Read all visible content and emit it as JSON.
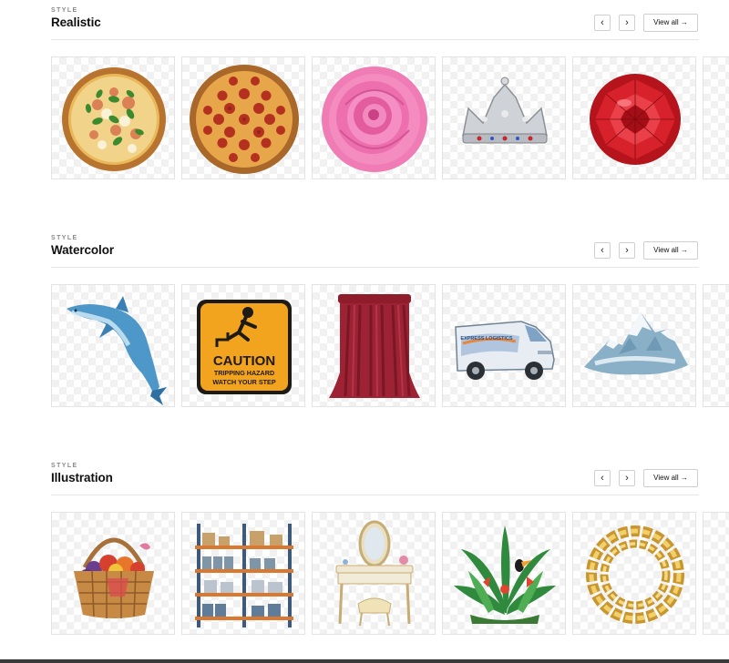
{
  "sections": [
    {
      "eyebrow": "STYLE",
      "title": "Realistic",
      "view_all": "View all →",
      "prev": "‹",
      "next": "›",
      "items": [
        "pizza-margherita",
        "pizza-pepperoni",
        "pink-rose",
        "silver-crown",
        "red-gemstone"
      ]
    },
    {
      "eyebrow": "STYLE",
      "title": "Watercolor",
      "view_all": "View all →",
      "prev": "‹",
      "next": "›",
      "items": [
        "dolphin",
        "caution-sign",
        "red-curtain",
        "delivery-van",
        "snowy-mountain"
      ],
      "caution_sign": {
        "headline": "CAUTION",
        "line1": "TRIPPING HAZARD",
        "line2": "WATCH YOUR STEP"
      },
      "van_text": "EXPRESS LOGISTICS"
    },
    {
      "eyebrow": "STYLE",
      "title": "Illustration",
      "view_all": "View all →",
      "prev": "‹",
      "next": "›",
      "items": [
        "fruit-basket",
        "warehouse-shelf",
        "vanity-table",
        "tropical-plants",
        "gold-chain"
      ]
    }
  ]
}
